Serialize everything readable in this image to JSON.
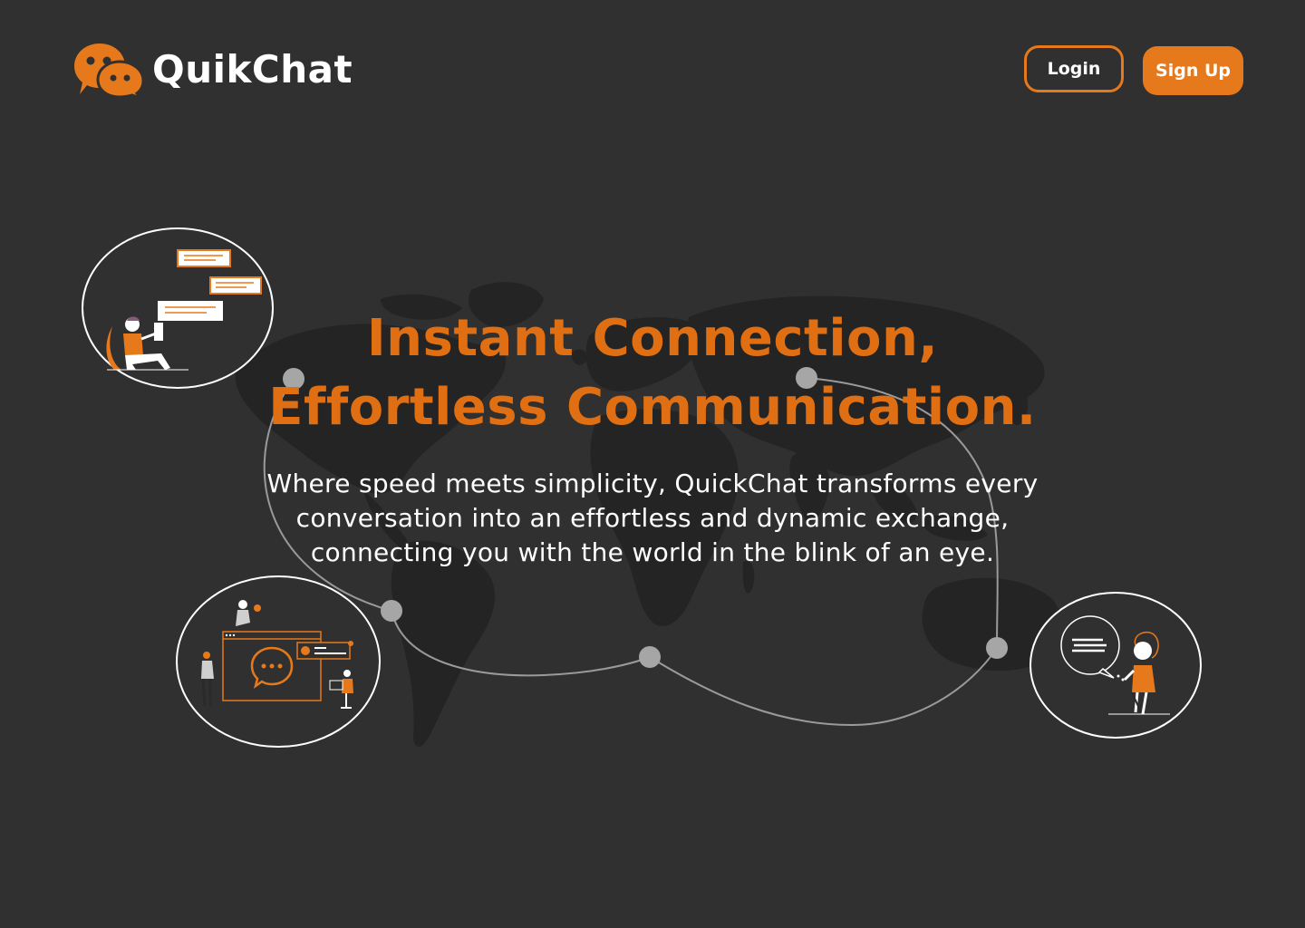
{
  "brand": {
    "name": "QuikChat",
    "logo_icon": "chat-bubbles-icon",
    "accent_color": "#e6791b",
    "background_color": "#303030"
  },
  "nav": {
    "login_label": "Login",
    "signup_label": "Sign Up"
  },
  "hero": {
    "title_line1": "Instant Connection,",
    "title_line2": "Effortless Communication.",
    "subtitle": "Where speed meets simplicity, QuickChat transforms every conversation into an effortless and dynamic exchange, connecting you with the world in the blink of an eye."
  },
  "illustrations": [
    {
      "name": "person-chatting-illustration"
    },
    {
      "name": "team-messaging-illustration"
    },
    {
      "name": "person-speech-bubble-illustration"
    }
  ]
}
